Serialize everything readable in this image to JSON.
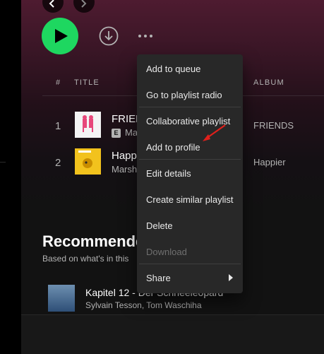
{
  "playlist": {
    "columns": {
      "number": "#",
      "title": "TITLE",
      "album": "ALBUM"
    },
    "tracks": [
      {
        "number": "1",
        "title": "FRIENDS",
        "artist": "Ma",
        "explicit": "E",
        "album": "FRIENDS"
      },
      {
        "number": "2",
        "title": "Happier",
        "artist": "Marsh",
        "album": "Happier"
      }
    ]
  },
  "recommended": {
    "heading": "Recommended",
    "subtitle": "Based on what's in this",
    "item": {
      "title": "Kapitel 12 - Der Schneeleopard",
      "artist": "Sylvain Tesson, Tom Waschiha"
    }
  },
  "context_menu": {
    "items": [
      {
        "label": "Add to queue",
        "disabled": false
      },
      {
        "label": "Go to playlist radio",
        "disabled": false
      },
      {
        "label": "Collaborative playlist",
        "disabled": false
      },
      {
        "label": "Add to profile",
        "disabled": false
      },
      {
        "label": "Edit details",
        "disabled": false
      },
      {
        "label": "Create similar playlist",
        "disabled": false
      },
      {
        "label": "Delete",
        "disabled": false
      },
      {
        "label": "Download",
        "disabled": true
      },
      {
        "label": "Share",
        "disabled": false,
        "has_submenu": true
      }
    ]
  },
  "colors": {
    "play_green": "#1ed760",
    "menu_bg": "#282828",
    "annotation_arrow": "#e0201b"
  },
  "icons": [
    "chevron-left-icon",
    "chevron-right-icon",
    "play-icon",
    "download-icon",
    "more-options-icon",
    "submenu-arrow-icon"
  ]
}
